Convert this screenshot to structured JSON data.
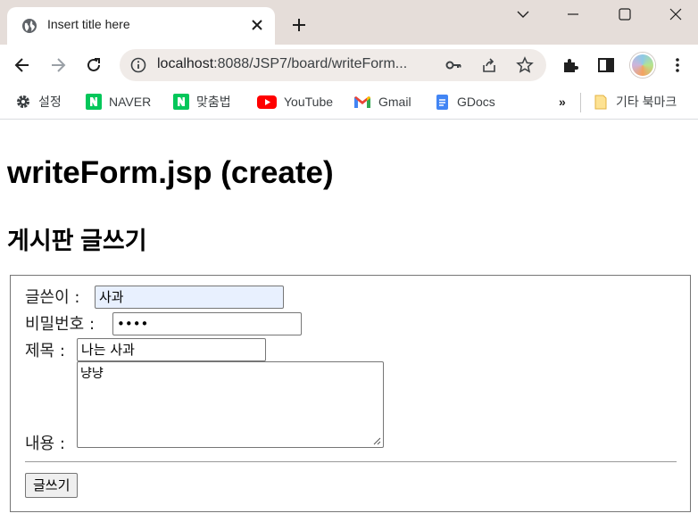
{
  "browser": {
    "tab": {
      "title": "Insert title here"
    },
    "url": {
      "host": "localhost",
      "path": ":8088/JSP7/board/writeForm..."
    },
    "bookmarks": [
      {
        "label": "설정",
        "icon": "gear-icon"
      },
      {
        "label": "NAVER",
        "icon": "naver-icon"
      },
      {
        "label": "맞춤법",
        "icon": "naver-icon"
      },
      {
        "label": "YouTube",
        "icon": "youtube-icon"
      },
      {
        "label": "Gmail",
        "icon": "gmail-icon"
      },
      {
        "label": "GDocs",
        "icon": "gdocs-icon"
      }
    ],
    "bookmarks_overflow": "»",
    "other_bookmarks": "기타 북마크"
  },
  "page": {
    "title": "writeForm.jsp (create)",
    "subtitle": "게시판 글쓰기"
  },
  "form": {
    "writer_label": "글쓴이 :",
    "writer_value": "사과",
    "password_label": "비밀번호 :",
    "password_value": "••••",
    "subject_label": "제목 :",
    "subject_value": "나는 사과",
    "content_label": "내용 :",
    "content_value": "냥냥",
    "submit_label": "글쓰기"
  },
  "colors": {
    "titlebar": "#e5ddd9",
    "omnibox": "#f0ebe8",
    "autofill": "#e8f0fe"
  }
}
